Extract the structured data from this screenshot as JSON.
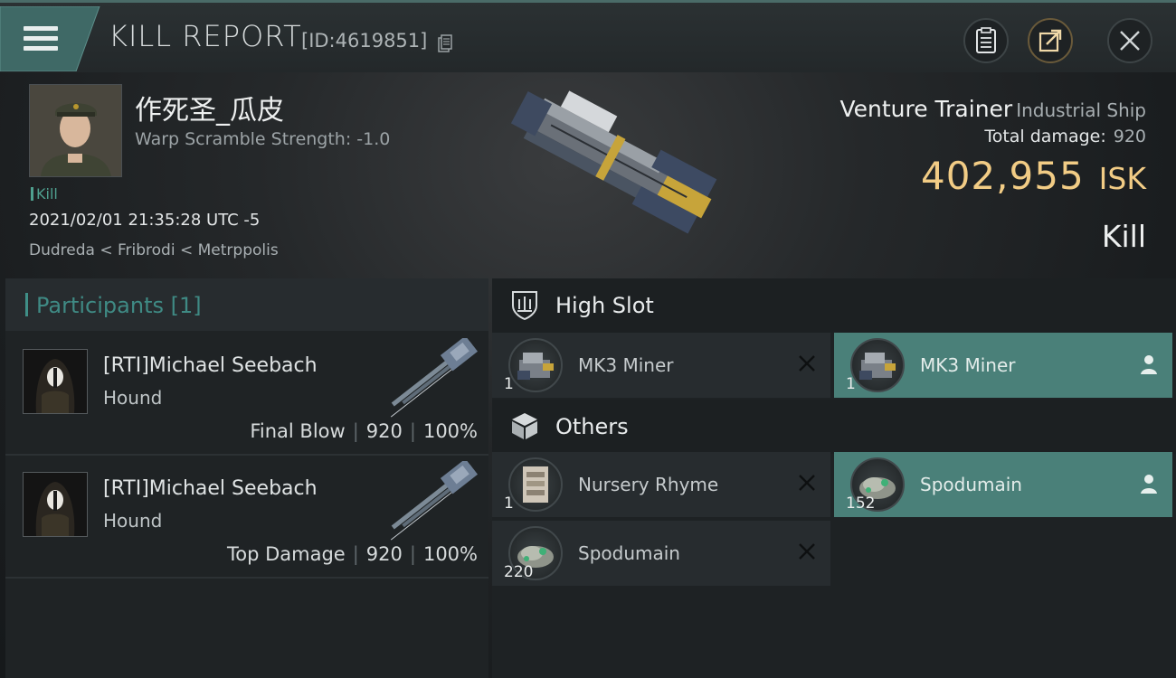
{
  "header": {
    "title": "KILL REPORT",
    "report_id": "[ID:4619851]",
    "icons": [
      "menu-icon",
      "copy-icon",
      "report-icon",
      "share-icon",
      "close-icon"
    ]
  },
  "victim": {
    "name": "作死圣_瓜皮",
    "warp_scramble": "Warp Scramble Strength: -1.0",
    "tag": "Kill",
    "datetime": "2021/02/01 21:35:28 UTC -5",
    "location": "Dudreda < Fribrodi < Metrppolis"
  },
  "ship": {
    "name": "Venture Trainer",
    "class": "Industrial Ship",
    "total_damage_label": "Total damage:",
    "total_damage_value": "920",
    "isk_value": "402,955",
    "isk_unit": "ISK",
    "result": "Kill"
  },
  "participants": {
    "title": "Participants [1]",
    "rows": [
      {
        "name": "[RTI]Michael Seebach",
        "ship": "Hound",
        "role": "Final Blow",
        "damage": "920",
        "percent": "100%"
      },
      {
        "name": "[RTI]Michael Seebach",
        "ship": "Hound",
        "role": "Top Damage",
        "damage": "920",
        "percent": "100%"
      }
    ]
  },
  "sections": {
    "high_slot": {
      "title": "High Slot",
      "items": [
        {
          "name": "MK3 Miner",
          "qty": "1",
          "state": "destroyed"
        },
        {
          "name": "MK3 Miner",
          "qty": "1",
          "state": "dropped"
        }
      ]
    },
    "others": {
      "title": "Others",
      "items": [
        {
          "name": "Nursery Rhyme",
          "qty": "1",
          "state": "destroyed"
        },
        {
          "name": "Spodumain",
          "qty": "152",
          "state": "dropped"
        },
        {
          "name": "Spodumain",
          "qty": "220",
          "state": "destroyed"
        }
      ]
    }
  },
  "colors": {
    "accent_teal": "#4a8079",
    "isk_gold": "#f2cc85",
    "participants_title": "#3f8a84"
  }
}
